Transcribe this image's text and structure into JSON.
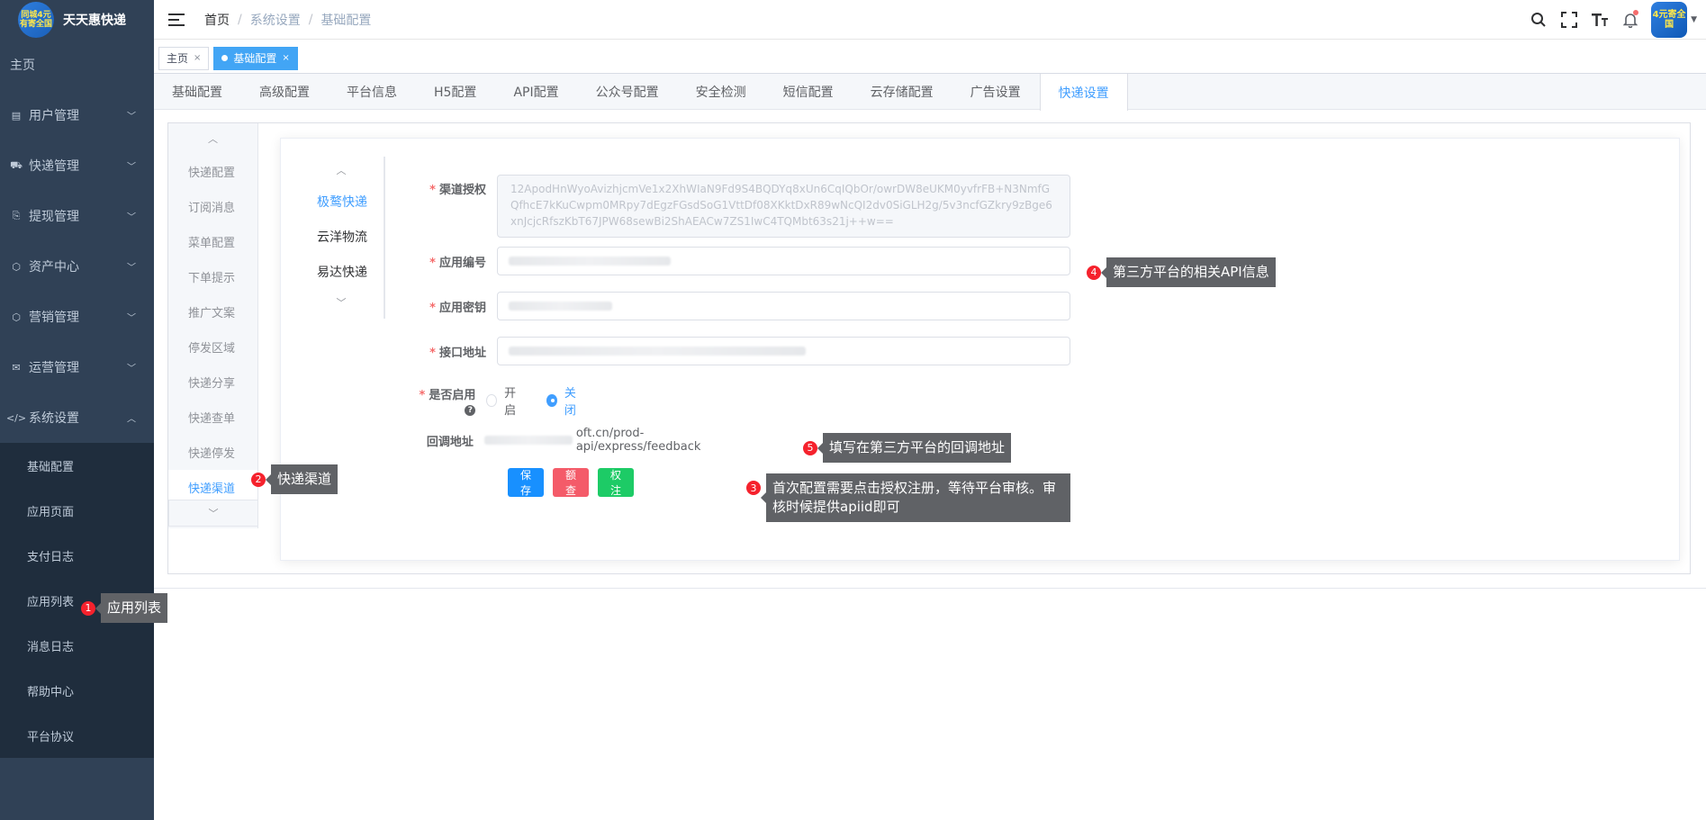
{
  "app": {
    "title": "天天惠快递",
    "logo_text": "同城4元有寄全国",
    "avatar_text": "4元寄全国"
  },
  "sidebar": {
    "home": "主页",
    "items": [
      {
        "label": "用户管理",
        "icon": "list-icon"
      },
      {
        "label": "快递管理",
        "icon": "truck-icon"
      },
      {
        "label": "提现管理",
        "icon": "wallet-icon"
      },
      {
        "label": "资产中心",
        "icon": "box-icon"
      },
      {
        "label": "营销管理",
        "icon": "box-icon"
      },
      {
        "label": "运营管理",
        "icon": "mail-icon"
      },
      {
        "label": "系统设置",
        "icon": "code-icon"
      }
    ],
    "submenu": [
      "基础配置",
      "应用页面",
      "支付日志",
      "应用列表",
      "消息日志",
      "帮助中心",
      "平台协议"
    ]
  },
  "breadcrumb": {
    "home": "首页",
    "level1": "系统设置",
    "level2": "基础配置"
  },
  "tags": {
    "home": "主页",
    "active": "基础配置"
  },
  "main_tabs": [
    "基础配置",
    "高级配置",
    "平台信息",
    "H5配置",
    "API配置",
    "公众号配置",
    "安全检测",
    "短信配置",
    "云存储配置",
    "广告设置",
    "快递设置"
  ],
  "left_nav": [
    "快递配置",
    "订阅消息",
    "菜单配置",
    "下单提示",
    "推广文案",
    "停发区域",
    "快递分享",
    "快递查单",
    "快递停发",
    "快递渠道"
  ],
  "vtabs": [
    "极鹜快递",
    "云洋物流",
    "易达快递"
  ],
  "form": {
    "channel_auth_label": "渠道授权",
    "channel_auth_value": "12ApodHnWyoAvizhjcmVe1x2XhWIaN9Fd9S4BQDYq8xUn6CqIQbOr/owrDW8eUKM0yvfrFB+N3NmfGQfhcE7kKuCwpm0MRpy7dEgzFGsdSoG1VttDf08XKktDxR89wNcQI2dv0SiGLH2g/5v3ncfGZkry9zBge6xnJcjcRfszKbT67JPW68sewBi2ShAEACw7ZS1IwC4TQMbt63s21j++w==",
    "app_id_label": "应用编号",
    "app_secret_label": "应用密钥",
    "api_url_label": "接口地址",
    "enable_label": "是否启用",
    "enable_on": "开启",
    "enable_off": "关闭",
    "callback_label": "回调地址",
    "callback_value": "oft.cn/prod-api/express/feedback",
    "btn_save": "保存",
    "btn_balance": "余额查询",
    "btn_register": "授权注册"
  },
  "annotations": {
    "a1": {
      "num": "1",
      "text": "应用列表"
    },
    "a2": {
      "num": "2",
      "text": "快递渠道"
    },
    "a3": {
      "num": "3",
      "text": "首次配置需要点击授权注册，等待平台审核。审核时候提供apiid即可"
    },
    "a4": {
      "num": "4",
      "text": "第三方平台的相关API信息"
    },
    "a5": {
      "num": "5",
      "text": "填写在第三方平台的回调地址"
    }
  },
  "colors": {
    "sidebar_bg": "#304156",
    "submenu_bg": "#1f2d3d",
    "accent": "#409eff",
    "tag_active": "#42a5f5"
  }
}
